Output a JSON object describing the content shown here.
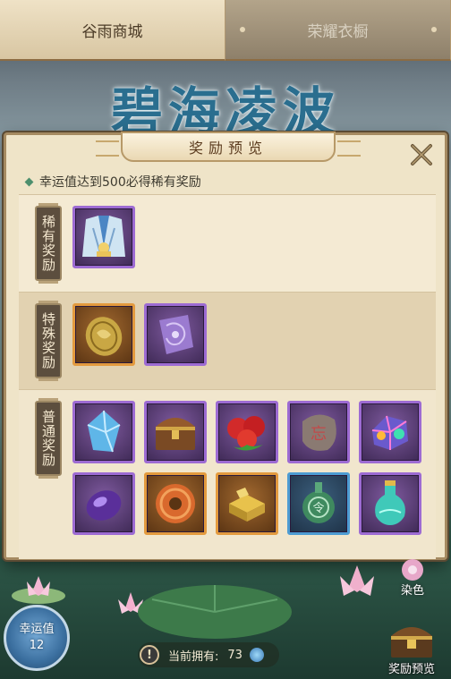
{
  "tabs": [
    {
      "label": "谷雨商城",
      "active": true
    },
    {
      "label": "荣耀衣橱",
      "active": false
    }
  ],
  "banner": "碧海凌波",
  "dialog": {
    "title": "奖励预览",
    "notice": "幸运值达到500必得稀有奖励",
    "sections": [
      {
        "label": "稀有奖励",
        "items": [
          {
            "icon": "costume-icon",
            "rarity": "purple"
          }
        ]
      },
      {
        "label": "特殊奖励",
        "items": [
          {
            "icon": "gold-jade-pendant-icon",
            "rarity": "orange"
          },
          {
            "icon": "purple-jade-pendant-icon",
            "rarity": "purple"
          }
        ]
      },
      {
        "label": "普通奖励",
        "items": [
          {
            "icon": "blue-crystal-icon",
            "rarity": "purple"
          },
          {
            "icon": "treasure-chest-icon",
            "rarity": "purple"
          },
          {
            "icon": "red-fruit-icon",
            "rarity": "purple"
          },
          {
            "icon": "rune-stone-icon",
            "rarity": "purple"
          },
          {
            "icon": "rainbow-gem-icon",
            "rarity": "purple"
          },
          {
            "icon": "purple-stone-icon",
            "rarity": "purple"
          },
          {
            "icon": "copper-coin-icon",
            "rarity": "orange"
          },
          {
            "icon": "gold-ingot-icon",
            "rarity": "orange"
          },
          {
            "icon": "jade-token-icon",
            "rarity": "blue"
          },
          {
            "icon": "potion-bottle-icon",
            "rarity": "purple"
          }
        ]
      }
    ]
  },
  "footer": {
    "lucky_label": "幸运值",
    "lucky_value": "12",
    "owned_label": "当前拥有:",
    "owned_count": "73",
    "dye_label": "染色",
    "preview_label": "奖励预览"
  },
  "colors": {
    "panel_bg": "#efe4c8",
    "label_bg": "#5c4e3e",
    "purple_frame": "#9d6bd3",
    "orange_frame": "#e39a3e",
    "blue_frame": "#4d9cd3",
    "banner_text": "#2a6e8f"
  }
}
